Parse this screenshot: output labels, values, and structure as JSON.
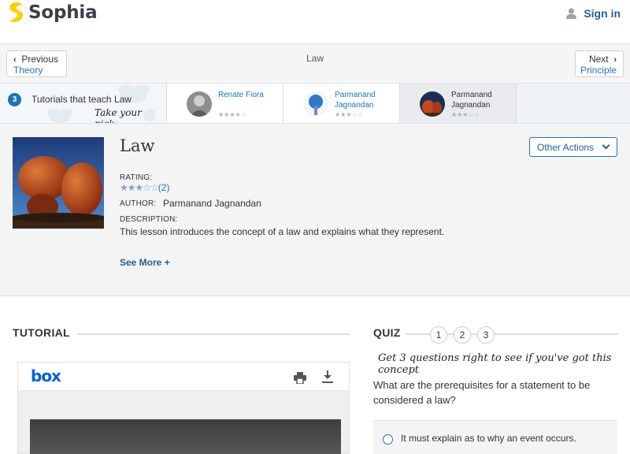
{
  "brand": {
    "name": "Sophia",
    "accent": "#1f73b7",
    "logo_color": "#f5d300"
  },
  "header": {
    "signin_label": "Sign in",
    "signin_icon": "user-icon"
  },
  "nav": {
    "prev_label": "Previous",
    "prev_topic": "Theory",
    "current": "Law",
    "next_label": "Next",
    "next_topic": "Principle"
  },
  "tutorials": {
    "count": "3",
    "label": "Tutorials that teach Law",
    "pick": "Take your pick:",
    "items": [
      {
        "author": "Renate Fiora",
        "stars": "★★★★☆",
        "active": false
      },
      {
        "author": "Parmanand Jagnandan",
        "stars": "★★★☆☆",
        "active": false
      },
      {
        "author": "Parmanand Jagnandan",
        "stars": "★★★☆☆",
        "active": true
      }
    ]
  },
  "lesson": {
    "title": "Law",
    "other_actions": "Other Actions",
    "rating_label": "RATING:",
    "rating_stars": "★★★☆☆",
    "rating_count": "(2)",
    "author_label": "AUTHOR:",
    "author": "Parmanand Jagnandan",
    "description_label": "DESCRIPTION:",
    "description": "This lesson introduces the concept of a law and explains what they represent.",
    "see_more": "See More +"
  },
  "tutorial": {
    "heading": "TUTORIAL",
    "viewer_brand": "box"
  },
  "quiz": {
    "heading": "QUIZ",
    "steps": [
      "1",
      "2",
      "3"
    ],
    "subtitle": "Get 3 questions right to see if you've got this concept",
    "question": "What are the prerequisites for a statement to be considered a law?",
    "options": [
      "It must explain as to why an event occurs."
    ]
  }
}
